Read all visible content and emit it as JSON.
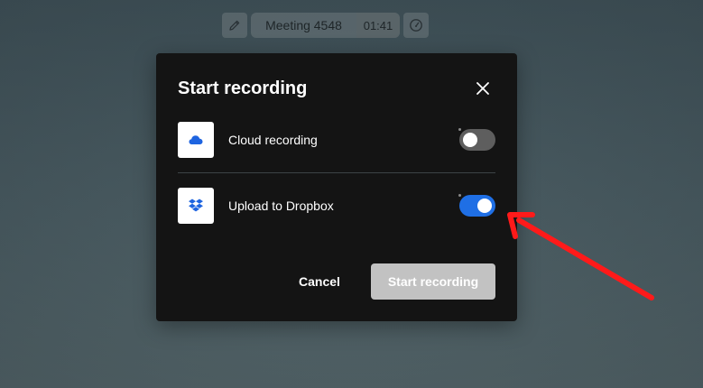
{
  "topbar": {
    "edit_icon": "pencil-icon",
    "meeting_name": "Meeting 4548",
    "timer": "01:41",
    "performance_icon": "speedometer-icon"
  },
  "modal": {
    "title": "Start recording",
    "close_icon": "close-icon",
    "options": [
      {
        "label": "Cloud recording",
        "icon": "cloud-icon",
        "enabled": false
      },
      {
        "label": "Upload to Dropbox",
        "icon": "dropbox-icon",
        "enabled": true
      }
    ],
    "cancel_label": "Cancel",
    "start_label": "Start recording"
  },
  "colors": {
    "modal_bg": "#141414",
    "toggle_on": "#1f6fe5",
    "toggle_off": "#5e5e5e",
    "icon_blue": "#1e64e0",
    "start_disabled_bg": "#c2c2c2",
    "annotation_red": "#ff1a1a"
  }
}
